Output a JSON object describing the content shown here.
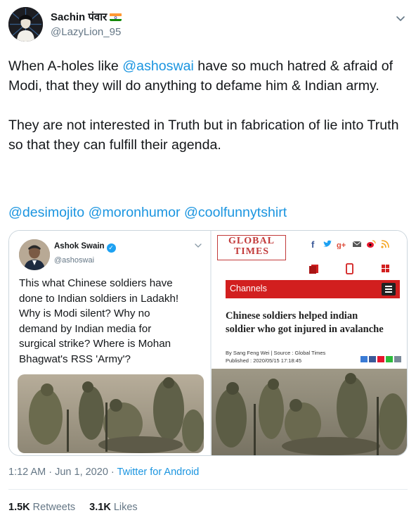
{
  "tweet": {
    "author_name": "Sachin पंवार",
    "author_handle": "@LazyLion_95",
    "text_before": "When A-holes like ",
    "text_mention": "@ashoswai",
    "text_after": " have so much hatred & afraid of Modi, that they will do anything to defame him & Indian army.\n\nThey are not interested in Truth but in fabrication of lie into Truth so that they can fulfill their agenda.",
    "mentions": [
      "@desimojito",
      "@moronhumor",
      "@coolfunnytshirt"
    ],
    "time": "1:12 AM",
    "date": "Jun 1, 2020",
    "source": "Twitter for Android",
    "retweets_count": "1.5K",
    "retweets_label": "Retweets",
    "likes_count": "3.1K",
    "likes_label": "Likes"
  },
  "quoted": {
    "author_name": "Ashok Swain",
    "author_handle": "@ashoswai",
    "text": "This what Chinese soldiers have\ndone to Indian  soldiers in Ladakh!\nWhy is Modi silent? Why no\ndemand by Indian media for\nsurgical strike? Where is Mohan\nBhagwat's RSS 'Army'?"
  },
  "article": {
    "logo_line1": "GLOBAL",
    "logo_line2": "TIMES",
    "channels_label": "Channels",
    "title": "Chinese soldiers helped indian\nsoldier who got injured in avalanche",
    "byline": "By Sang Feng Wei | Source : Global Times",
    "published": "Published : 2020/05/15 17:18:45"
  },
  "colors": {
    "link": "#1b95e0",
    "muted": "#657786",
    "text": "#14171a",
    "brand_red": "#d21f1f"
  }
}
